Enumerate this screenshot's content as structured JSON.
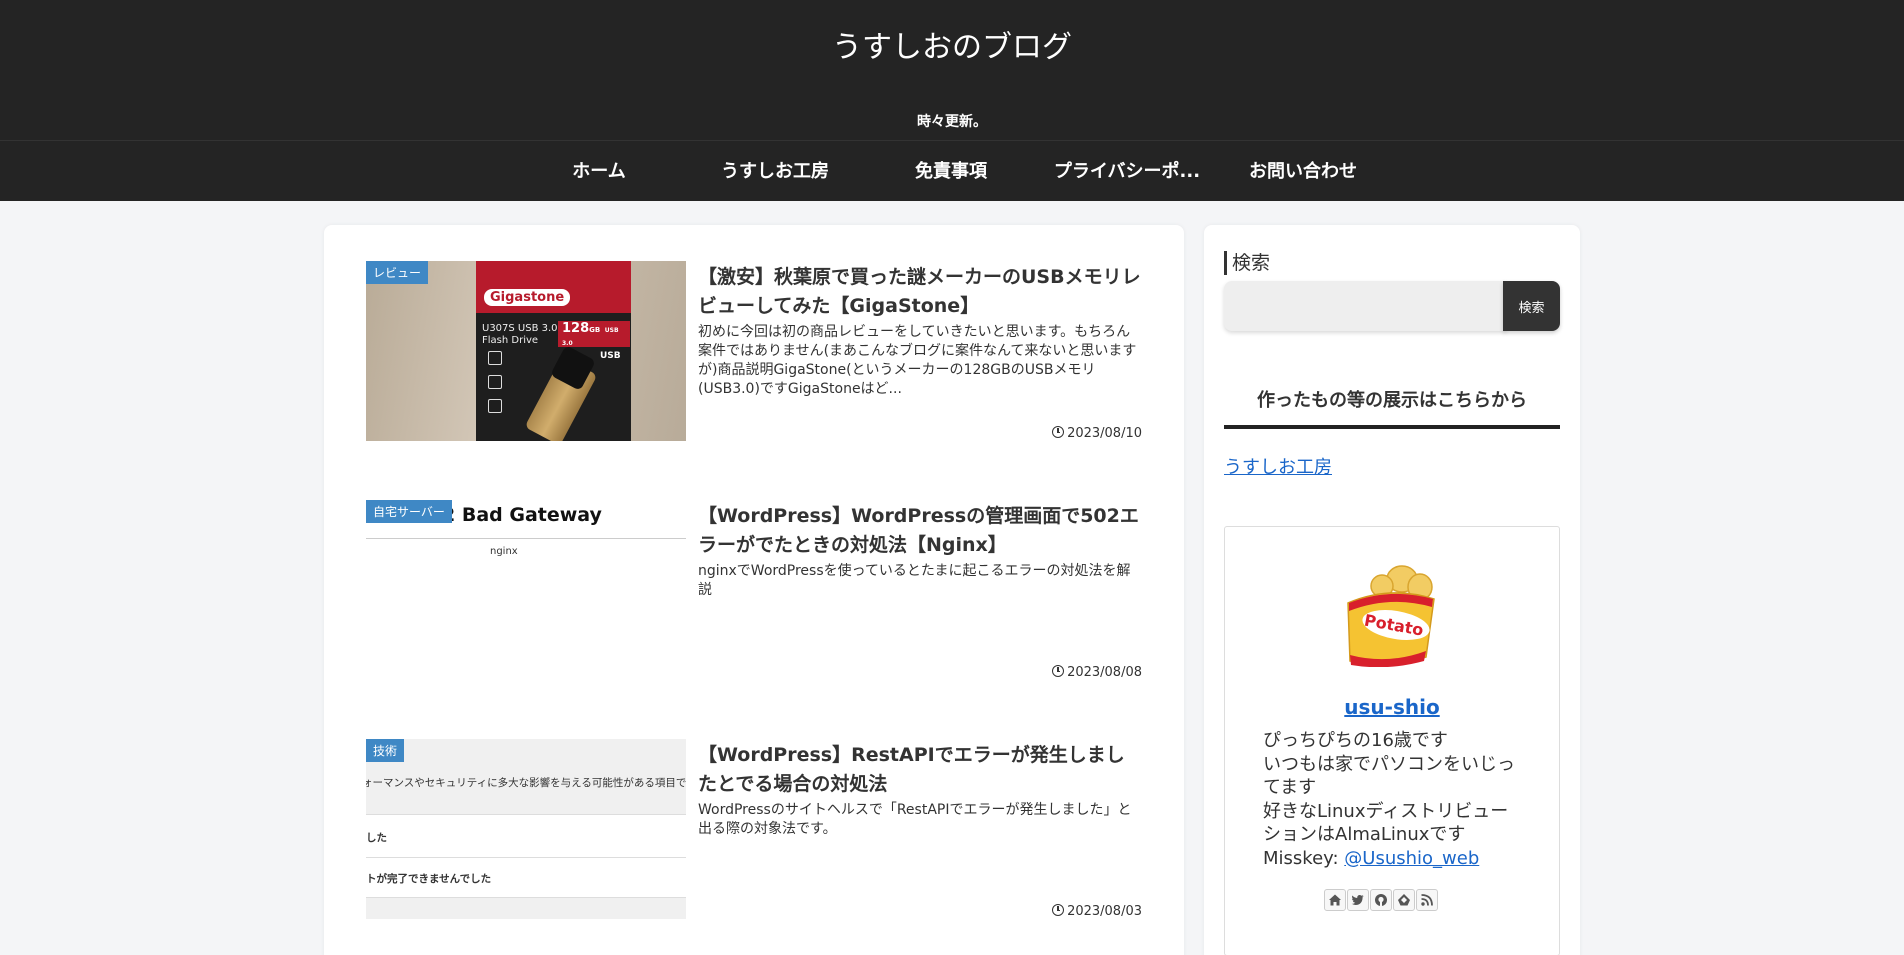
{
  "site": {
    "title": "うすしおのブログ",
    "tagline": "時々更新。"
  },
  "nav": [
    {
      "label": "ホーム"
    },
    {
      "label": "うすしお工房"
    },
    {
      "label": "免責事項"
    },
    {
      "label": "プライバシーポ..."
    },
    {
      "label": "お問い合わせ"
    }
  ],
  "posts": [
    {
      "category": "レビュー",
      "title": "【激安】秋葉原で買った謎メーカーのUSBメモリレビューしてみた【GigaStone】",
      "excerpt": "初めに今回は初の商品レビューをしていきたいと思います。もちろん案件ではありません(まあこんなブログに案件なんて来ないと思いますが)商品説明GigaStone(というメーカーの128GBのUSBメモリ(USB3.0)ですGigaStoneはど...",
      "date": "2023/08/10",
      "thumb": {
        "logo": "Gigastone",
        "line1": "U307S USB 3.0",
        "line2": "Flash Drive",
        "capacity": "128",
        "capacity_unit": "GB",
        "usb": "USB 3.0",
        "usb_word": "USB"
      }
    },
    {
      "category": "自宅サーバー",
      "title": "【WordPress】WordPressの管理画面で502エラーがでたときの対処法【Nginx】",
      "excerpt": "nginxでWordPressを使っているとたまに起こるエラーの対処法を解説",
      "date": "2023/08/08",
      "thumb": {
        "heading": "2 Bad Gateway",
        "server": "nginx"
      }
    },
    {
      "category": "技術",
      "title": "【WordPress】RestAPIでエラーが発生しましたとでる場合の対処法",
      "excerpt": "WordPressのサイトヘルスで「RestAPIでエラーが発生しました」と出る際の対象法です。",
      "date": "2023/08/03",
      "thumb": {
        "line1": "ォーマンスやセキュリティに多大な影響を与える可能性がある項目です",
        "line2": "した",
        "line3": "トが完了できませんでした"
      }
    }
  ],
  "sidebar": {
    "search_heading": "検索",
    "search_value": "",
    "search_button": "検索",
    "works_heading": "作ったもの等の展示はこちらから",
    "works_link": "うすしお工房",
    "profile": {
      "avatar_text": "Potato",
      "name": "usu-shio",
      "bio_lines": [
        "ぴっちぴちの16歳です",
        "いつもは家でパソコンをいじってます",
        "好きなLinuxディストリビューションはAlmaLinuxです"
      ],
      "misskey_label": "Misskey: ",
      "misskey_handle": "@Usushio_web",
      "sns_icons": [
        "home-icon",
        "twitter-icon",
        "github-icon",
        "feedly-icon",
        "rss-icon"
      ]
    }
  },
  "colors": {
    "header_bg": "#242424",
    "category_badge": "#3f88c5",
    "link": "#1a66c9"
  }
}
